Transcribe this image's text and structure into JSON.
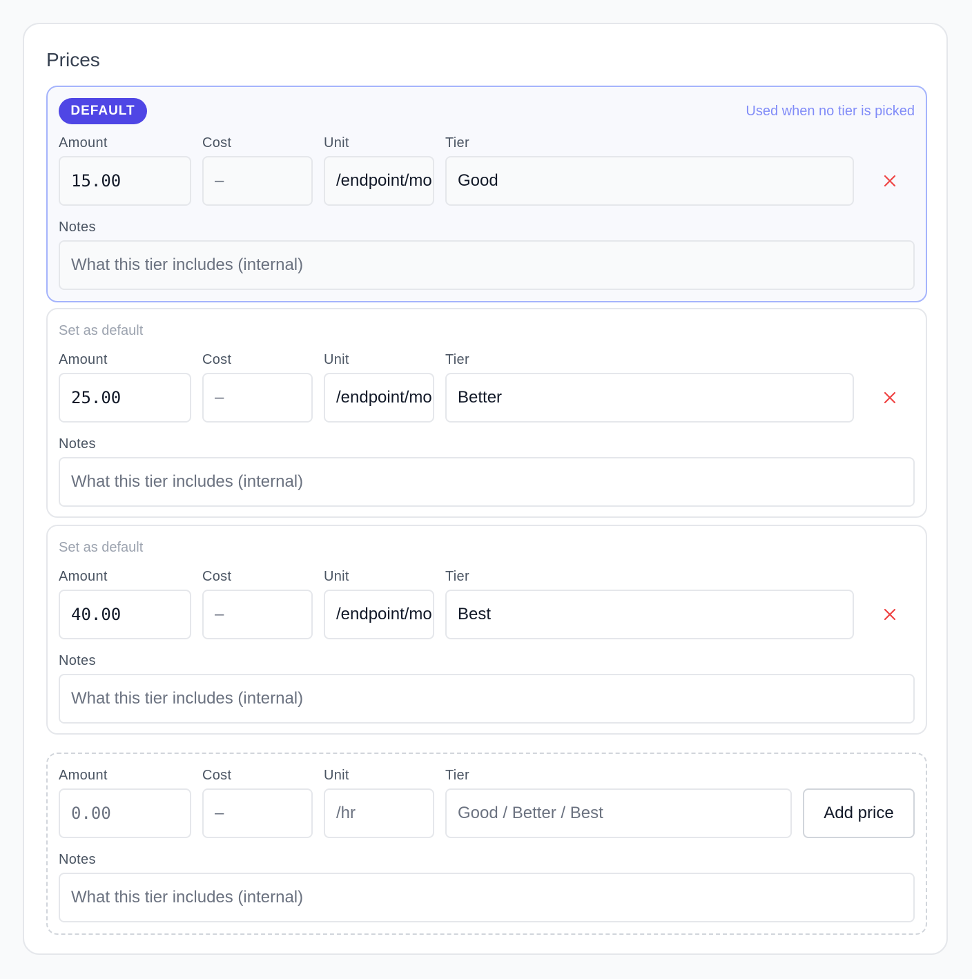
{
  "panel": {
    "title": "Prices"
  },
  "labels": {
    "amount": "Amount",
    "cost": "Cost",
    "unit": "Unit",
    "tier": "Tier",
    "notes": "Notes"
  },
  "default_badge": "DEFAULT",
  "default_hint": "Used when no tier is picked",
  "set_default_label": "Set as default",
  "notes_placeholder": "What this tier includes (internal)",
  "prices": [
    {
      "amount": "15.00",
      "cost": "–",
      "unit": "/endpoint/mo",
      "tier": "Good",
      "is_default": true
    },
    {
      "amount": "25.00",
      "cost": "–",
      "unit": "/endpoint/mo",
      "tier": "Better",
      "is_default": false
    },
    {
      "amount": "40.00",
      "cost": "–",
      "unit": "/endpoint/mo",
      "tier": "Best",
      "is_default": false
    }
  ],
  "new_price": {
    "amount_placeholder": "0.00",
    "cost_placeholder": "–",
    "unit_placeholder": "/hr",
    "tier_placeholder": "Good / Better / Best",
    "add_button": "Add price"
  },
  "colors": {
    "accent": "#4f46e5",
    "accent_light": "#818cf8",
    "danger": "#ef4444",
    "border": "#e5e7eb"
  },
  "icons": {
    "remove": "close-icon"
  }
}
